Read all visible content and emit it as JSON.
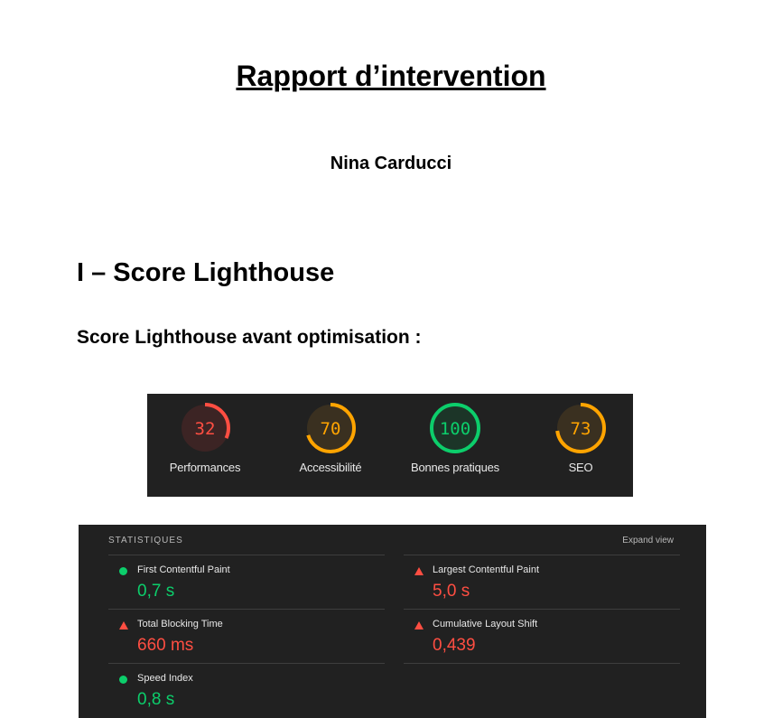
{
  "document": {
    "title": "Rapport d’intervention",
    "author": "Nina Carducci",
    "section_heading": "I – Score Lighthouse",
    "subheading": "Score Lighthouse avant optimisation :"
  },
  "gauges": [
    {
      "score": "32",
      "label": "Performances",
      "color": "#ff4e42",
      "fill": "#3c2424"
    },
    {
      "score": "70",
      "label": "Accessibilité",
      "color": "#ffa400",
      "fill": "#3a3020"
    },
    {
      "score": "100",
      "label": "Bonnes pratiques",
      "color": "#0cce6b",
      "fill": "#1c3528"
    },
    {
      "score": "73",
      "label": "SEO",
      "color": "#ffa400",
      "fill": "#3a3020"
    }
  ],
  "stats": {
    "heading": "STATISTIQUES",
    "expand_label": "Expand view",
    "metrics": [
      {
        "name": "First Contentful Paint",
        "value": "0,7 s",
        "status": "good"
      },
      {
        "name": "Largest Contentful Paint",
        "value": "5,0 s",
        "status": "bad"
      },
      {
        "name": "Total Blocking Time",
        "value": "660 ms",
        "status": "bad"
      },
      {
        "name": "Cumulative Layout Shift",
        "value": "0,439",
        "status": "bad"
      },
      {
        "name": "Speed Index",
        "value": "0,8 s",
        "status": "good"
      }
    ]
  }
}
